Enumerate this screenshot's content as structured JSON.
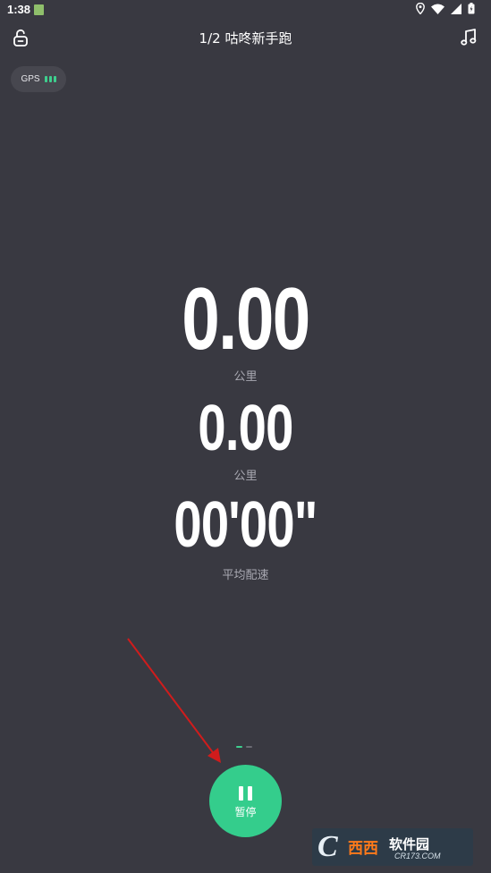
{
  "status_bar": {
    "time": "1:38",
    "icons": [
      "app-notification-icon",
      "location-icon",
      "wifi-icon",
      "signal-icon",
      "battery-icon"
    ]
  },
  "header": {
    "title": "1/2 咕咚新手跑",
    "left_icon": "lock-icon",
    "right_icon": "music-note-icon"
  },
  "gps": {
    "label": "GPS",
    "signal_bars": 3,
    "color": "#3ecf8e"
  },
  "metrics": {
    "distance": {
      "value": "0.00",
      "unit": "公里"
    },
    "second": {
      "value": "0.00",
      "unit": "公里"
    },
    "pace": {
      "value": "00'00\"",
      "unit": "平均配速"
    }
  },
  "pager": {
    "current": 1,
    "total": 2
  },
  "controls": {
    "pause_label": "暂停",
    "pause_icon": "pause-icon",
    "accent": "#34cd8c"
  },
  "annotation": {
    "color": "#d01c1c"
  },
  "watermark": {
    "logo_letter": "C",
    "brand": "西西",
    "name": "软件园",
    "url": "CR173.COM"
  }
}
